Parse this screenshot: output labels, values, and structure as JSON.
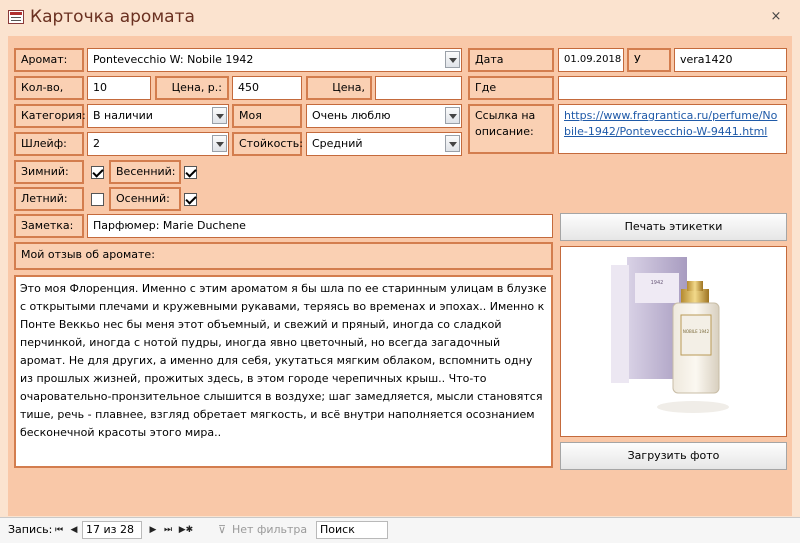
{
  "window": {
    "title": "Карточка аромата",
    "close": "×"
  },
  "labels": {
    "aroma": "Аромат:",
    "purchase_date": "Дата покупки:",
    "from_whom": "У кого:",
    "quantity": "Кол-во, мл:",
    "price_rub": "Цена, р.:",
    "price_ue": "Цена, у.е.:",
    "where_sold": "Где продается:",
    "category": "Категория:",
    "my_rating": "Моя оценка:",
    "link_desc": "Ссылка на описание:",
    "trail": "Шлейф:",
    "longevity": "Стойкость:",
    "winter": "Зимний:",
    "spring": "Весенний:",
    "summer": "Летний:",
    "autumn": "Осенний:",
    "note": "Заметка:",
    "review": "Мой отзыв об аромате:"
  },
  "values": {
    "aroma": "Pontevecchio W: Nobile 1942",
    "purchase_date": "01.09.2018",
    "from_whom": "vera1420",
    "quantity": "10",
    "price_rub": "450",
    "price_ue": "",
    "where_sold": "",
    "category": "В наличии",
    "my_rating": "Очень люблю",
    "link": "https://www.fragrantica.ru/perfume/Nobile-1942/Pontevecchio-W-9441.html",
    "trail": "2",
    "longevity": "Средний",
    "winter": true,
    "spring": true,
    "summer": false,
    "autumn": true,
    "note": "Парфюмер: Marie Duchene",
    "review": "Это моя Флоренция. Именно с этим ароматом я бы шла по ее старинным улицам в блузке с открытыми плечами и кружевными рукавами, теряясь во временах и эпохах.. Именно к Понте Веккьо нес бы меня этот объемный, и свежий и пряный, иногда со сладкой перчинкой, иногда с нотой пудры, иногда явно цветочный, но всегда загадочный аромат. Не для других, а именно для себя, укутаться мягким облаком, вспомнить одну из прошлых жизней, прожитых здесь, в этом городе черепичных крыш.. Что-то очаровательно-пронзительное слышится в воздухе; шаг замедляется, мысли становятся тише, речь - плавнее, взгляд обретает мягкость, и всё внутри наполняется осознанием бесконечной красоты этого мира.."
  },
  "buttons": {
    "print_labels": "Печать этикетки",
    "upload_photo": "Загрузить фото"
  },
  "photo": {
    "bottle_label": "NOBILE 1942"
  },
  "statusbar": {
    "record_label": "Запись:",
    "first": "⏮",
    "prev": "◀",
    "position": "17 из 28",
    "next": "▶",
    "last": "⏭",
    "new": "▶✱",
    "filter": "Нет фильтра",
    "search": "Поиск"
  }
}
